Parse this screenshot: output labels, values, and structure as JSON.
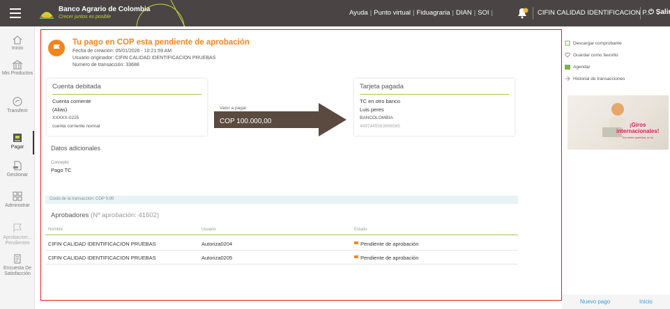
{
  "topbar": {
    "bank_name": "Banco Agrario de Colombia",
    "tagline": "Crecer juntos es posible",
    "links": [
      "Ayuda",
      "Punto virtual",
      "Fiduagraria",
      "DIAN",
      "SOI"
    ],
    "company": "CIFIN CALIDAD IDENTIFICACION P...",
    "logout": "Salir",
    "accent_color": "#c6d83a",
    "background_color": "#4a4544"
  },
  "sidenav": {
    "items": [
      {
        "label": "Inicio",
        "icon": "home-icon"
      },
      {
        "label": "Mis Productos",
        "icon": "bank-icon"
      },
      {
        "label": "Transferir",
        "icon": "transfer-icon"
      },
      {
        "label": "Pagar",
        "icon": "payment-icon",
        "active": true
      },
      {
        "label": "Gestionar",
        "icon": "manage-document-icon"
      },
      {
        "label": "Administrar",
        "icon": "grid-icon"
      },
      {
        "label": "Aprobacion... Pendientes",
        "icon": "flag-icon"
      },
      {
        "label": "Encuesta De Satisfacción",
        "icon": "survey-icon"
      }
    ]
  },
  "header": {
    "title": "Tu pago en COP esta pendiente de aprobación",
    "fecha": "Fecha de creación: 05/01/2026 - 10:21:59 AM",
    "usuario": "Usuario originador: CIFIN CALIDAD IDENTIFICACION PRUEBAS",
    "transaccion": "Numero de transacción: 33688",
    "status_color": "#f4841d"
  },
  "debit_card": {
    "title": "Cuenta debitada",
    "type": "Cuenta corriente",
    "alias": "(Alias)",
    "number": "XXXXX-0225",
    "description": "cuenta corriente normal"
  },
  "transfer": {
    "label": "Valor a pagar",
    "amount": "COP 100.000,00"
  },
  "credit_card": {
    "title": "Tarjeta pagada",
    "type": "TC en otro banco",
    "holder": "Luis peres",
    "bank": "BANCOLOMBIA",
    "number": "4497445563896565"
  },
  "additional": {
    "title": "Datos adicionales",
    "concept_label": "Concepto",
    "concept_value": "Pago TC"
  },
  "cost": "Costo de la transacción: COP 0,00",
  "approvers": {
    "title": "Aprobadores",
    "subtitle": "(Nº aprobación: 41602)",
    "columns": [
      "Nombre",
      "Usuario",
      "Estado"
    ],
    "rows": [
      {
        "name": "CIFIN CALIDAD IDENTIFICACION PRUEBAS",
        "user": "Autoriza0204",
        "status": "Pendiente de aprobación"
      },
      {
        "name": "CIFIN CALIDAD IDENTIFICACION PRUEBAS",
        "user": "Autoriza0205",
        "status": "Pendiente de aprobación"
      }
    ]
  },
  "actions": [
    {
      "label": "Descargar comprobante",
      "icon": "download-icon"
    },
    {
      "label": "Guardar como favorito",
      "icon": "heart-icon"
    },
    {
      "label": "Agendar",
      "icon": "calendar-icon"
    },
    {
      "label": "Historial de transacciones",
      "icon": "history-icon"
    }
  ],
  "banner": {
    "headline_1": "¡Giros",
    "headline_2": "internacionales!",
    "subtext": "Tus seres queridos, en tu"
  },
  "footer": {
    "new_payment": "Nuevo pago",
    "home": "Inicio",
    "link_color": "#3f9bd1"
  }
}
